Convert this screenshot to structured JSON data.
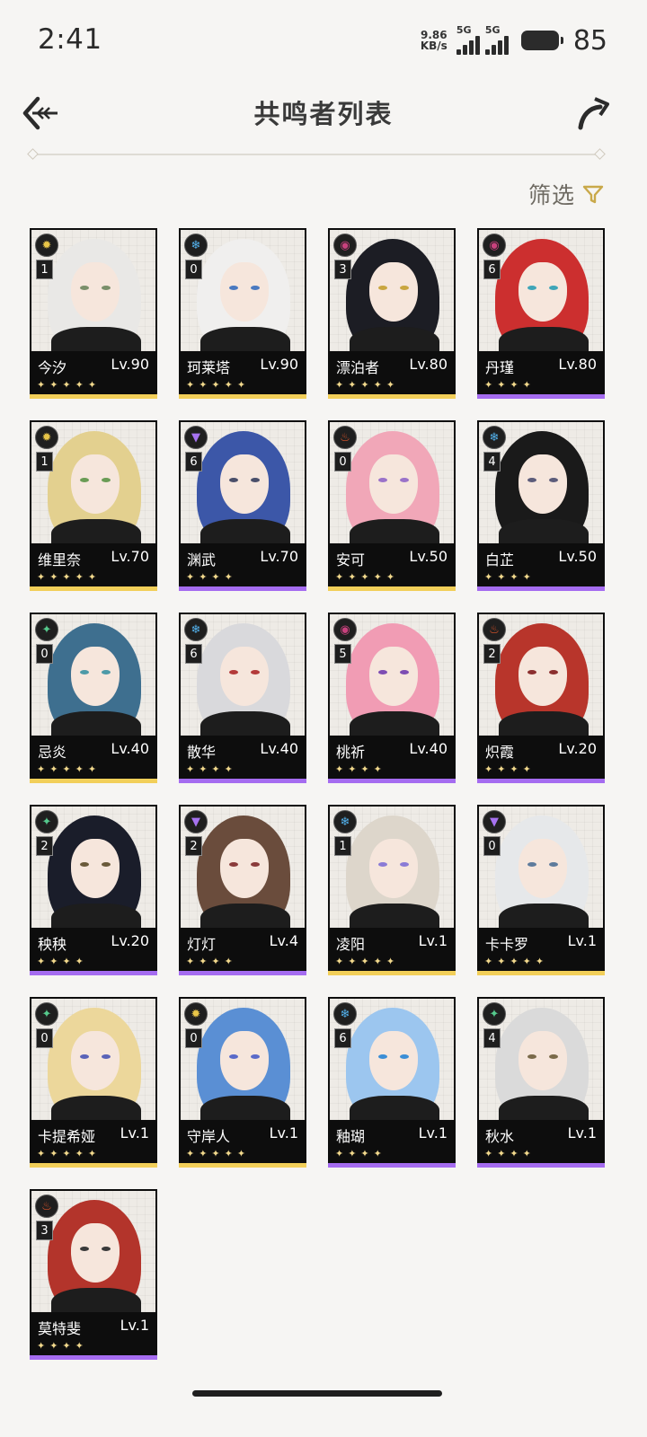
{
  "status_bar": {
    "time": "2:41",
    "net_speed_value": "9.86",
    "net_speed_unit": "KB/s",
    "sim1_label": "5G",
    "sim2_label": "5G",
    "battery": "85"
  },
  "header": {
    "title": "共鸣者列表",
    "back_icon": "back-arrow-icon",
    "share_icon": "share-icon"
  },
  "filter": {
    "label": "筛选",
    "icon": "filter-icon"
  },
  "colors": {
    "five_star": "#f2cf59",
    "four_star": "#a56cf0",
    "spectro": "#e8c548",
    "glacio": "#54b4f0",
    "havoc": "#c8417d",
    "fusion": "#e4562a",
    "aero": "#55c98c",
    "electro": "#a672f0"
  },
  "characters": [
    {
      "name": "今汐",
      "level": "Lv.90",
      "sequence": "1",
      "element": "spectro",
      "rarity": 5
    },
    {
      "name": "珂莱塔",
      "level": "Lv.90",
      "sequence": "0",
      "element": "glacio",
      "rarity": 5
    },
    {
      "name": "漂泊者",
      "level": "Lv.80",
      "sequence": "3",
      "element": "havoc",
      "rarity": 5
    },
    {
      "name": "丹瑾",
      "level": "Lv.80",
      "sequence": "6",
      "element": "havoc",
      "rarity": 4
    },
    {
      "name": "维里奈",
      "level": "Lv.70",
      "sequence": "1",
      "element": "spectro",
      "rarity": 5
    },
    {
      "name": "渊武",
      "level": "Lv.70",
      "sequence": "6",
      "element": "electro",
      "rarity": 4
    },
    {
      "name": "安可",
      "level": "Lv.50",
      "sequence": "0",
      "element": "fusion",
      "rarity": 5
    },
    {
      "name": "白芷",
      "level": "Lv.50",
      "sequence": "4",
      "element": "glacio",
      "rarity": 4
    },
    {
      "name": "忌炎",
      "level": "Lv.40",
      "sequence": "0",
      "element": "aero",
      "rarity": 5
    },
    {
      "name": "散华",
      "level": "Lv.40",
      "sequence": "6",
      "element": "glacio",
      "rarity": 4
    },
    {
      "name": "桃祈",
      "level": "Lv.40",
      "sequence": "5",
      "element": "havoc",
      "rarity": 4
    },
    {
      "name": "炽霞",
      "level": "Lv.20",
      "sequence": "2",
      "element": "fusion",
      "rarity": 4
    },
    {
      "name": "秧秧",
      "level": "Lv.20",
      "sequence": "2",
      "element": "aero",
      "rarity": 4
    },
    {
      "name": "灯灯",
      "level": "Lv.4",
      "sequence": "2",
      "element": "electro",
      "rarity": 4
    },
    {
      "name": "凌阳",
      "level": "Lv.1",
      "sequence": "1",
      "element": "glacio",
      "rarity": 5
    },
    {
      "name": "卡卡罗",
      "level": "Lv.1",
      "sequence": "0",
      "element": "electro",
      "rarity": 5
    },
    {
      "name": "卡提希娅",
      "level": "Lv.1",
      "sequence": "0",
      "element": "aero",
      "rarity": 5
    },
    {
      "name": "守岸人",
      "level": "Lv.1",
      "sequence": "0",
      "element": "spectro",
      "rarity": 5
    },
    {
      "name": "釉瑚",
      "level": "Lv.1",
      "sequence": "6",
      "element": "glacio",
      "rarity": 4
    },
    {
      "name": "秋水",
      "level": "Lv.1",
      "sequence": "4",
      "element": "aero",
      "rarity": 4
    },
    {
      "name": "莫特斐",
      "level": "Lv.1",
      "sequence": "3",
      "element": "fusion",
      "rarity": 4
    }
  ]
}
